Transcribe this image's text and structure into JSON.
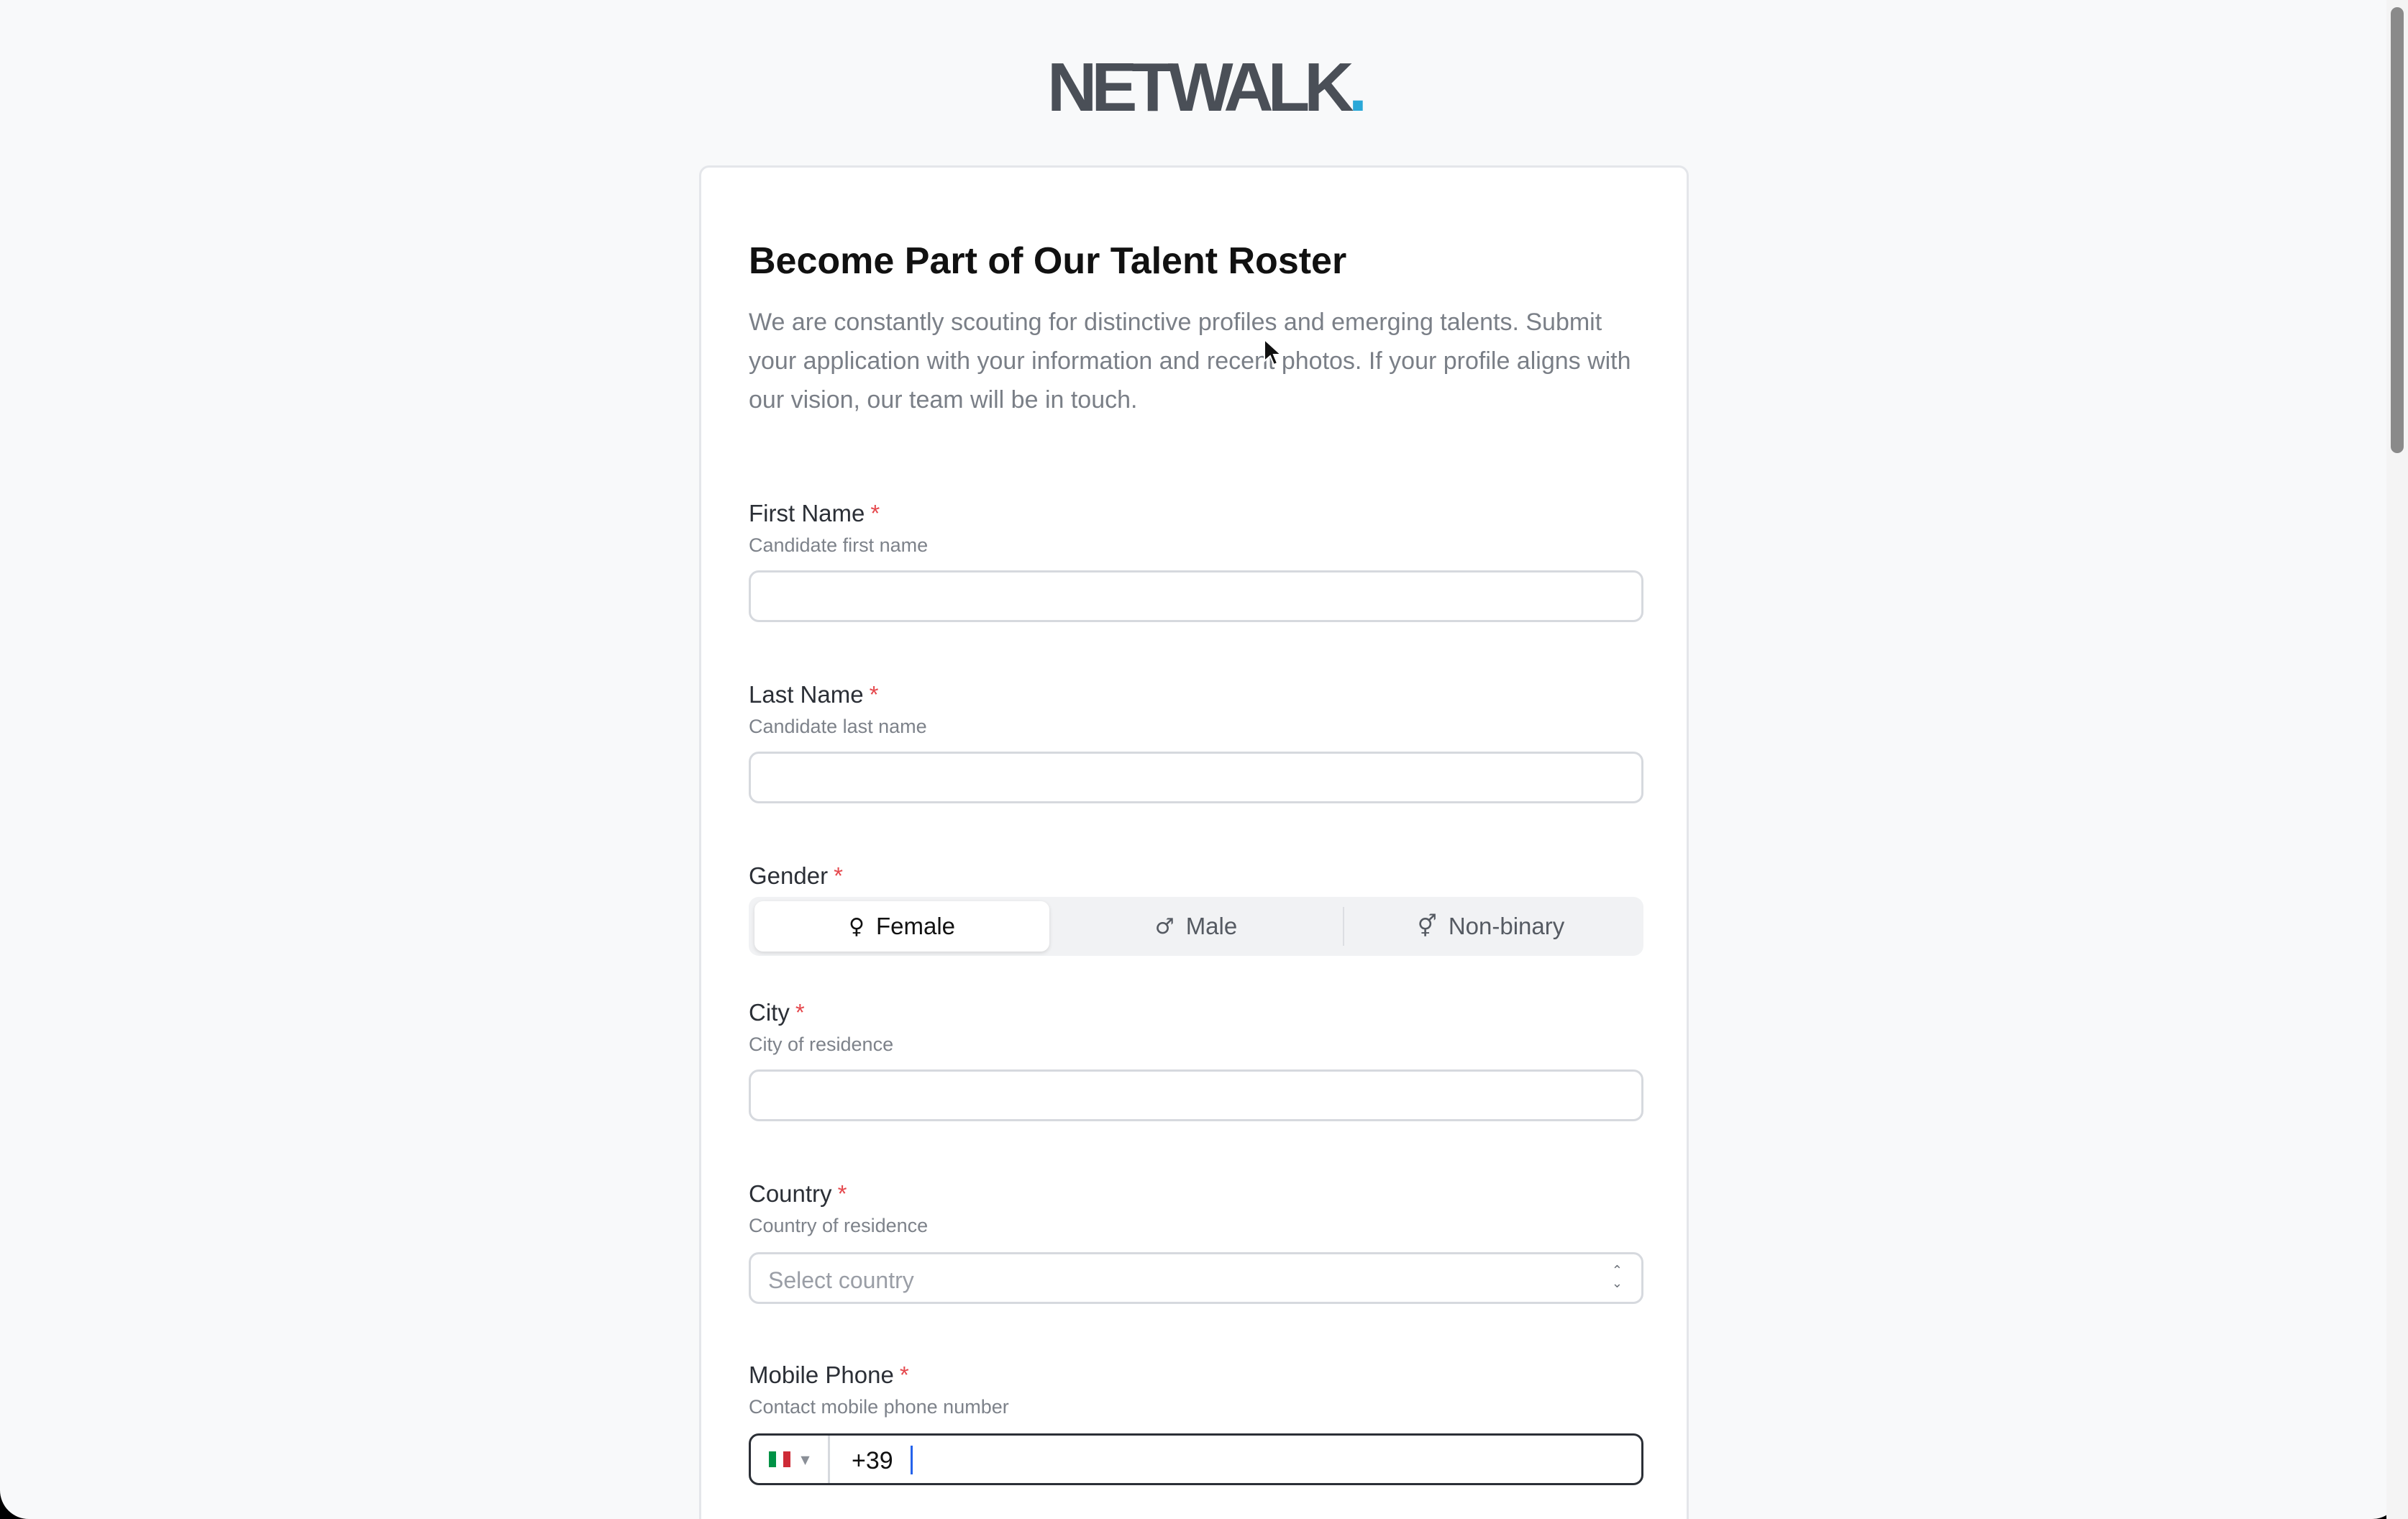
{
  "brand": {
    "logo_text": "NETWALK",
    "logo_dot": ".",
    "accent_color": "#2aa8d8"
  },
  "form": {
    "title": "Become Part of Our Talent Roster",
    "subtitle": "We are constantly scouting for distinctive profiles and emerging talents. Submit your application with your information and recent photos. If your profile aligns with our vision, our team will be in touch.",
    "required_mark": "*",
    "first_name": {
      "label": "First Name",
      "help": "Candidate first name",
      "value": ""
    },
    "last_name": {
      "label": "Last Name",
      "help": "Candidate last name",
      "value": ""
    },
    "gender": {
      "label": "Gender",
      "selected": "Female",
      "options": [
        {
          "label": "Female",
          "icon": "female-symbol-icon",
          "glyph": "♀"
        },
        {
          "label": "Male",
          "icon": "male-symbol-icon",
          "glyph": "♂"
        },
        {
          "label": "Non-binary",
          "icon": "non-binary-symbol-icon",
          "glyph": "⚥"
        }
      ]
    },
    "city": {
      "label": "City",
      "help": "City of residence",
      "value": ""
    },
    "country": {
      "label": "Country",
      "help": "Country of residence",
      "placeholder": "Select country"
    },
    "mobile_phone": {
      "label": "Mobile Phone",
      "help": "Contact mobile phone number",
      "country_flag": "italy-flag-icon",
      "value": "+39"
    }
  }
}
